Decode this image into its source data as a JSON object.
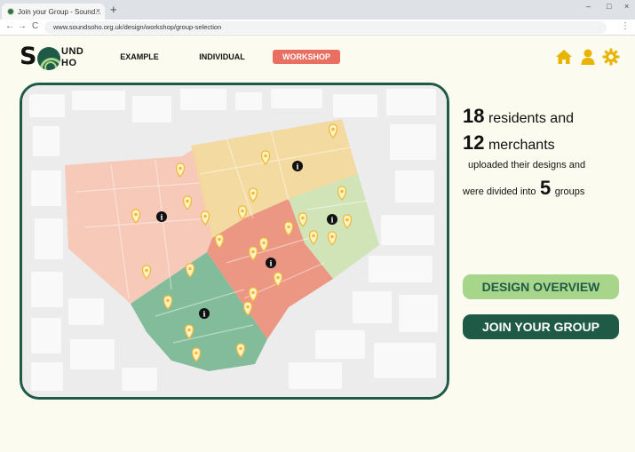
{
  "browser": {
    "tab_title": "Join your Group - Sound...",
    "tab_close": "×",
    "new_tab": "+",
    "win_minimize": "–",
    "win_maximize": "□",
    "win_close": "×",
    "nav_back": "←",
    "nav_forward": "→",
    "nav_reload": "C",
    "url": "www.soundsoho.org.uk/design/workshop/group-selection",
    "menu": "⋮"
  },
  "logo": {
    "letter": "S",
    "top": "UND",
    "bottom": "HO"
  },
  "nav": {
    "items": [
      {
        "label": "EXAMPLE",
        "active": false
      },
      {
        "label": "INDIVIDUAL",
        "active": false
      },
      {
        "label": "WORKSHOP",
        "active": true
      }
    ]
  },
  "header_icons": [
    "home-icon",
    "user-icon",
    "gear-icon"
  ],
  "colors": {
    "brand_dark": "#1f5a47",
    "brand_light": "#a7d58a",
    "accent_red": "#e96f63",
    "icon_yellow": "#e8b400",
    "background": "#fbfbef"
  },
  "map": {
    "zones": [
      {
        "name": "pink",
        "color": "#f6c6b4"
      },
      {
        "name": "yellow",
        "color": "#f3d89a"
      },
      {
        "name": "light-green",
        "color": "#cfe4b5"
      },
      {
        "name": "red",
        "color": "#ea8f7b"
      },
      {
        "name": "dark-green",
        "color": "#7cb996"
      }
    ],
    "info_marker": "i"
  },
  "stats": {
    "residents_count": "18",
    "residents_label": "residents and",
    "merchants_count": "12",
    "merchants_label": "merchants",
    "uploaded_text": "uploaded their designs and",
    "divided_text": "were divided into",
    "groups_count": "5",
    "groups_label": "groups"
  },
  "buttons": {
    "overview": "DESIGN OVERVIEW",
    "join": "JOIN YOUR GROUP"
  }
}
